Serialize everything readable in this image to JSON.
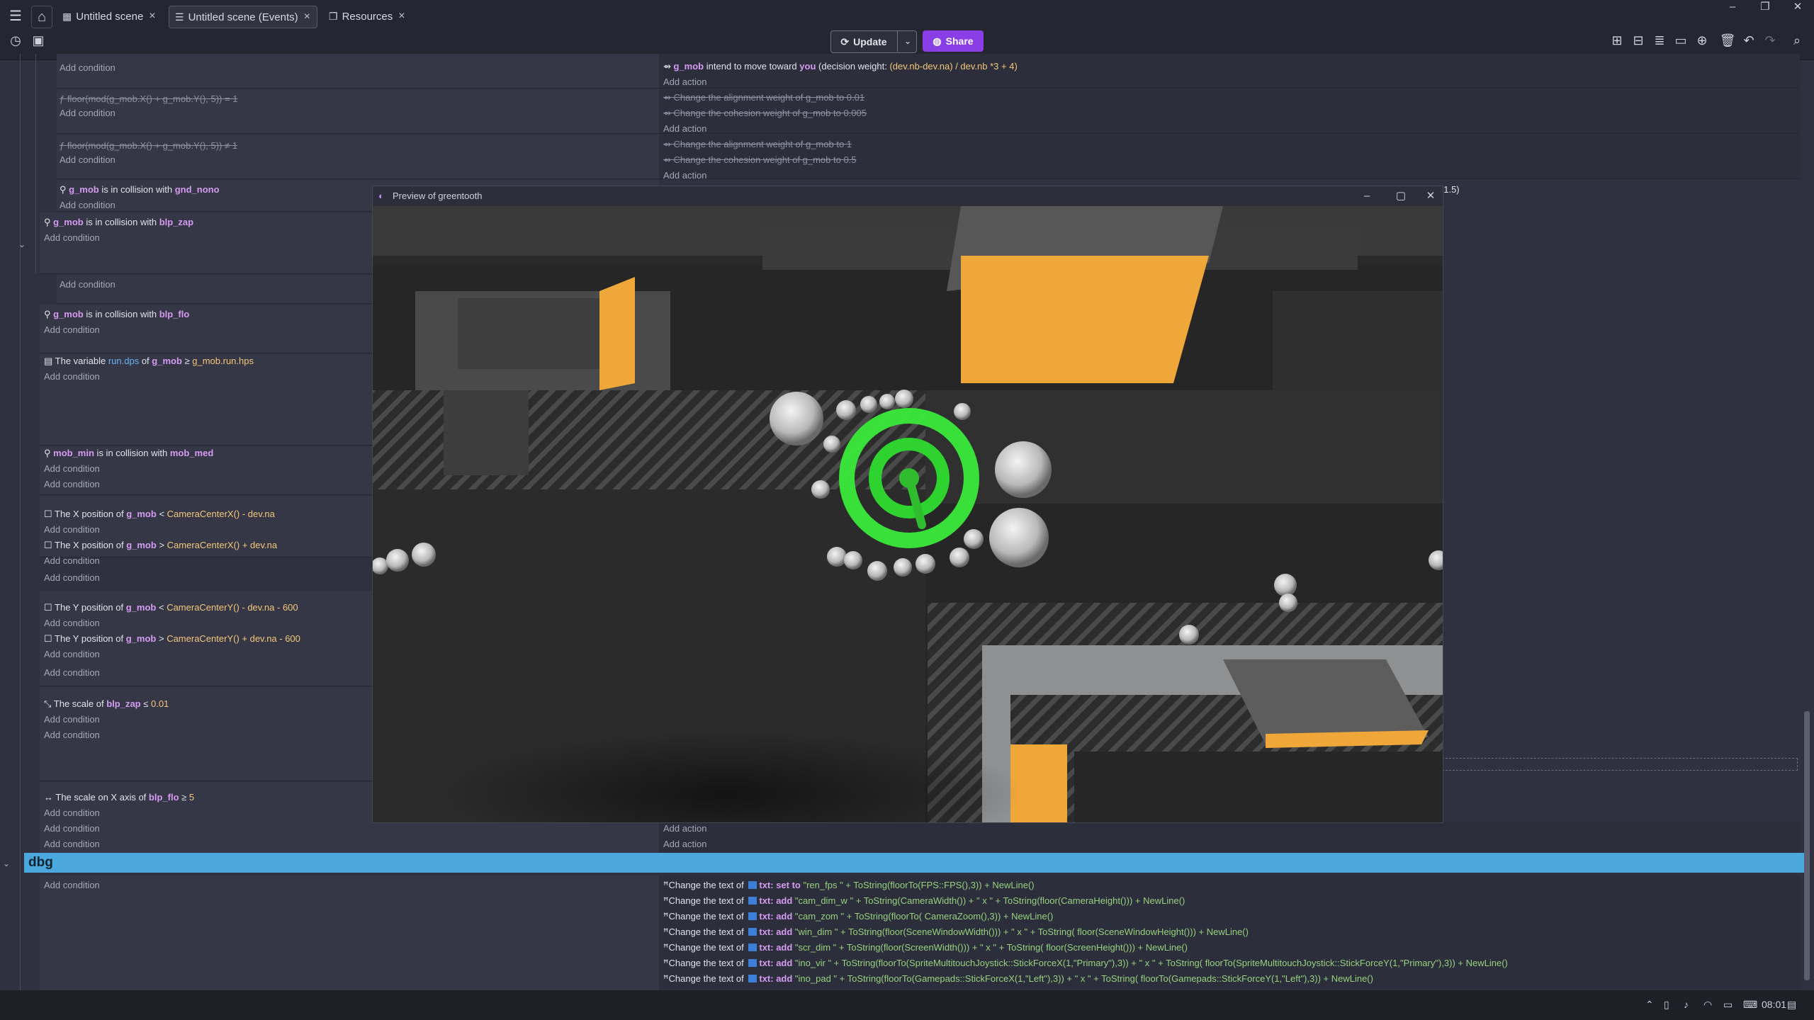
{
  "tabs": {
    "home_icon": "home-icon",
    "menu_icon": "hamburger-icon",
    "items": [
      {
        "label": "Untitled scene"
      },
      {
        "label": "Untitled scene (Events)"
      },
      {
        "label": "Resources"
      }
    ]
  },
  "toolbar": {
    "update_label": "Update",
    "share_label": "Share"
  },
  "events": {
    "add_condition": "Add condition",
    "add_action": "Add action",
    "row1": {
      "a_mob": "g_mob",
      "a_text1": " intend to move toward ",
      "a_you": "you",
      "a_text2": " (decision weight: ",
      "a_expr": "(dev.nb-dev.na) / dev.nb *3 + 4)"
    },
    "row2": {
      "cond": "floor(mod(g_mob.X() + g_mob.Y(), 5)) = 1",
      "act1": "Change the alignment weight of g_mob to 0.01",
      "act2": "Change the cohesion weight of g_mob to 0.005"
    },
    "row3": {
      "cond": "floor(mod(g_mob.X() + g_mob.Y(), 5)) ≠ 1",
      "act1": "Change the alignment weight of g_mob to 1",
      "act2": "Change the cohesion weight of g_mob to 0.5"
    },
    "row4": {
      "obj": "g_mob",
      "text": " is in collision with ",
      "obj2": "gnd_nono"
    },
    "row4_act_partial": ": 1.5)",
    "row5": {
      "obj": "g_mob",
      "text": " is in collision with ",
      "obj2": "blp_zap"
    },
    "row6": {
      "obj": "g_mob",
      "text": " is in collision with ",
      "obj2": "blp_flo"
    },
    "row7": {
      "prefix": "The variable ",
      "var": "run.dps",
      "text": " of ",
      "obj": "g_mob",
      "op": " ≥ ",
      "expr": "g_mob.run.hps"
    },
    "row8": {
      "obj": "mob_min",
      "text": " is in collision with ",
      "obj2": "mob_med"
    },
    "row9": [
      {
        "prefix": "The X position of ",
        "obj": "g_mob",
        "op": " < ",
        "expr": "CameraCenterX() - dev.na"
      },
      {
        "prefix": "The X position of ",
        "obj": "g_mob",
        "op": " > ",
        "expr": "CameraCenterX() + dev.na"
      }
    ],
    "row10": [
      {
        "prefix": "The Y position of ",
        "obj": "g_mob",
        "op": " < ",
        "expr": "CameraCenterY() - dev.na - 600"
      },
      {
        "prefix": "The Y position of ",
        "obj": "g_mob",
        "op": " > ",
        "expr": "CameraCenterY() + dev.na - 600"
      }
    ],
    "row11": {
      "prefix": "The scale of ",
      "obj": "blp_zap",
      "op": " ≤ ",
      "val": "0.01"
    },
    "row12": {
      "prefix": "The scale on X axis of ",
      "obj": "blp_flo",
      "op": " ≥ ",
      "val": "5"
    },
    "dbg_group": "dbg",
    "dbg_actions": [
      {
        "pre": "Change the text of ",
        "obj": "txt",
        "mode": ": set to ",
        "expr": "\"ren_fps \" + ToString(floorTo(FPS::FPS(),3)) + NewLine()"
      },
      {
        "pre": "Change the text of ",
        "obj": "txt",
        "mode": ": add ",
        "expr": "\"cam_dim_w \" + ToString(CameraWidth()) + \" x \" + ToString(floor(CameraHeight())) + NewLine()"
      },
      {
        "pre": "Change the text of ",
        "obj": "txt",
        "mode": ": add ",
        "expr": "\"cam_zom \" + ToString(floorTo( CameraZoom(),3)) + NewLine()"
      },
      {
        "pre": "Change the text of ",
        "obj": "txt",
        "mode": ": add ",
        "expr": "\"win_dim \" + ToString(floor(SceneWindowWidth())) + \" x \" + ToString( floor(SceneWindowHeight())) + NewLine()"
      },
      {
        "pre": "Change the text of ",
        "obj": "txt",
        "mode": ": add ",
        "expr": "\"scr_dim \" + ToString(floor(ScreenWidth())) + \" x \" + ToString( floor(ScreenHeight())) + NewLine()"
      },
      {
        "pre": "Change the text of ",
        "obj": "txt",
        "mode": ": add ",
        "expr": "\"ino_vir \" + ToString(floorTo(SpriteMultitouchJoystick::StickForceX(1,\"Primary\"),3)) + \" x \" + ToString( floorTo(SpriteMultitouchJoystick::StickForceY(1,\"Primary\"),3)) + NewLine()"
      },
      {
        "pre": "Change the text of ",
        "obj": "txt",
        "mode": ": add ",
        "expr": "\"ino_pad \" + ToString(floorTo(Gamepads::StickForceX(1,\"Left\"),3)) + \" x \" + ToString( floorTo(Gamepads::StickForceY(1,\"Left\"),3)) + NewLine()"
      }
    ]
  },
  "preview": {
    "title": "Preview of greentooth"
  },
  "statusbar": {
    "time": "08:01"
  },
  "colors": {
    "accent": "#8a3ee6",
    "group": "#4aa8df",
    "object": "#d59bf0",
    "number": "#f3c77a"
  }
}
